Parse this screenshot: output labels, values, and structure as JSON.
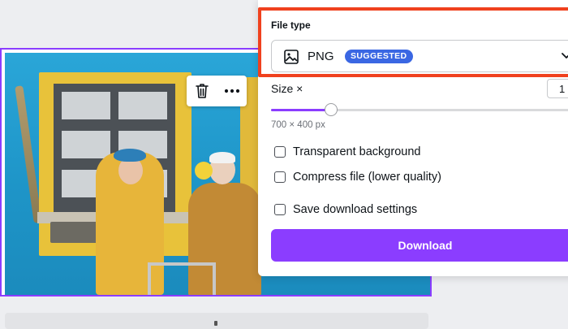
{
  "panel": {
    "file_type_label": "File type",
    "file_type_value": "PNG",
    "suggested_badge": "SUGGESTED",
    "badge_color": "#3a67e3",
    "size_label": "Size ×",
    "size_value": "1",
    "size_slider_fraction": 0.2,
    "dimensions": "700 × 400 px",
    "options": [
      {
        "label": "Transparent background",
        "checked": false
      },
      {
        "label": "Compress file (lower quality)",
        "checked": false
      },
      {
        "label": "Save download settings",
        "checked": false
      }
    ],
    "download_label": "Download",
    "accent_color": "#8b3dff",
    "highlight_color": "#f0411e"
  },
  "toolbar": {
    "icons": [
      "trash-icon",
      "more-icon"
    ]
  }
}
